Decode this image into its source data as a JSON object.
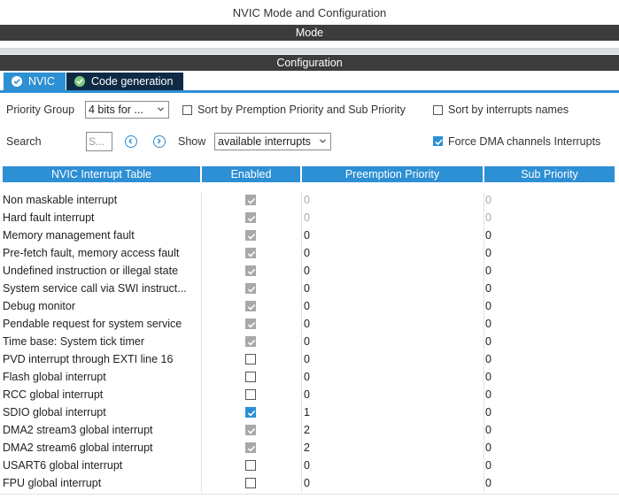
{
  "window": {
    "title": "NVIC Mode and Configuration"
  },
  "sections": {
    "mode": "Mode",
    "configuration": "Configuration"
  },
  "tabs": [
    {
      "label": "NVIC",
      "active": true
    },
    {
      "label": "Code generation",
      "active": false
    }
  ],
  "controls": {
    "priority_group_label": "Priority Group",
    "priority_group_value": "4 bits for ...",
    "sort_premption_label": "Sort by Premption Priority and Sub Priority",
    "sort_premption_checked": false,
    "sort_names_label": "Sort by interrupts names",
    "sort_names_checked": false,
    "search_label": "Search",
    "search_placeholder": "S...",
    "show_label": "Show",
    "show_value": "available interrupts",
    "force_dma_label": "Force DMA channels Interrupts",
    "force_dma_checked": true
  },
  "table": {
    "headers": [
      "NVIC Interrupt Table",
      "Enabled",
      "Preemption Priority",
      "Sub Priority"
    ],
    "rows": [
      {
        "name": "Non maskable interrupt",
        "enabled": "locked",
        "preemption": "0",
        "sub": "0",
        "editable": false
      },
      {
        "name": "Hard fault interrupt",
        "enabled": "locked",
        "preemption": "0",
        "sub": "0",
        "editable": false
      },
      {
        "name": "Memory management fault",
        "enabled": "locked",
        "preemption": "0",
        "sub": "0",
        "editable": true
      },
      {
        "name": "Pre-fetch fault, memory access fault",
        "enabled": "locked",
        "preemption": "0",
        "sub": "0",
        "editable": true
      },
      {
        "name": "Undefined instruction or illegal state",
        "enabled": "locked",
        "preemption": "0",
        "sub": "0",
        "editable": true
      },
      {
        "name": "System service call via SWI instruct...",
        "enabled": "locked",
        "preemption": "0",
        "sub": "0",
        "editable": true
      },
      {
        "name": "Debug monitor",
        "enabled": "locked",
        "preemption": "0",
        "sub": "0",
        "editable": true
      },
      {
        "name": "Pendable request for system service",
        "enabled": "locked",
        "preemption": "0",
        "sub": "0",
        "editable": true
      },
      {
        "name": "Time base: System tick timer",
        "enabled": "locked",
        "preemption": "0",
        "sub": "0",
        "editable": true
      },
      {
        "name": "PVD interrupt through EXTI line 16",
        "enabled": "off",
        "preemption": "0",
        "sub": "0",
        "editable": true
      },
      {
        "name": "Flash global interrupt",
        "enabled": "off",
        "preemption": "0",
        "sub": "0",
        "editable": true
      },
      {
        "name": "RCC global interrupt",
        "enabled": "off",
        "preemption": "0",
        "sub": "0",
        "editable": true
      },
      {
        "name": "SDIO global interrupt",
        "enabled": "on",
        "preemption": "1",
        "sub": "0",
        "editable": true
      },
      {
        "name": "DMA2 stream3 global interrupt",
        "enabled": "locked",
        "preemption": "2",
        "sub": "0",
        "editable": true
      },
      {
        "name": "DMA2 stream6 global interrupt",
        "enabled": "locked",
        "preemption": "2",
        "sub": "0",
        "editable": true
      },
      {
        "name": "USART6 global interrupt",
        "enabled": "off",
        "preemption": "0",
        "sub": "0",
        "editable": true
      },
      {
        "name": "FPU global interrupt",
        "enabled": "off",
        "preemption": "0",
        "sub": "0",
        "editable": true
      }
    ]
  },
  "colors": {
    "accent": "#2d8fd4",
    "dark_bar": "#3c3c3c",
    "tab_inactive": "#0e2a45",
    "locked_check": "#a8a8a8"
  }
}
